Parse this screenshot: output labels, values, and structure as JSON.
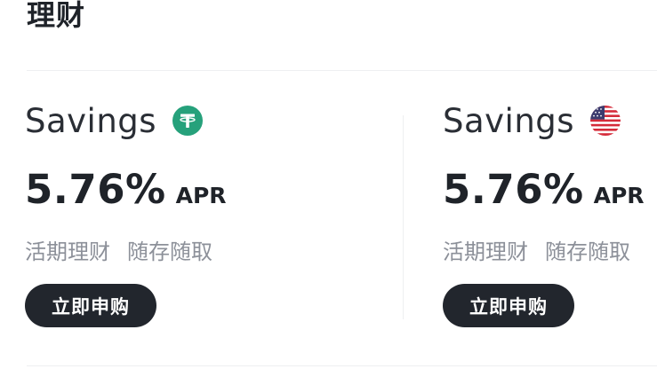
{
  "section": {
    "title": "理财"
  },
  "cards": [
    {
      "title": "Savings",
      "icon": "tether-usdt-icon",
      "rate": "5.76%",
      "rate_unit": "APR",
      "tags": [
        "活期理财",
        "随存随取"
      ],
      "button_label": "立即申购"
    },
    {
      "title": "Savings",
      "icon": "us-flag-icon",
      "rate": "5.76%",
      "rate_unit": "APR",
      "tags": [
        "活期理财",
        "随存随取"
      ],
      "button_label": "立即申购"
    }
  ],
  "colors": {
    "tether_green": "#26a17b",
    "button_dark": "#22262d",
    "muted_text": "#8c9099"
  }
}
